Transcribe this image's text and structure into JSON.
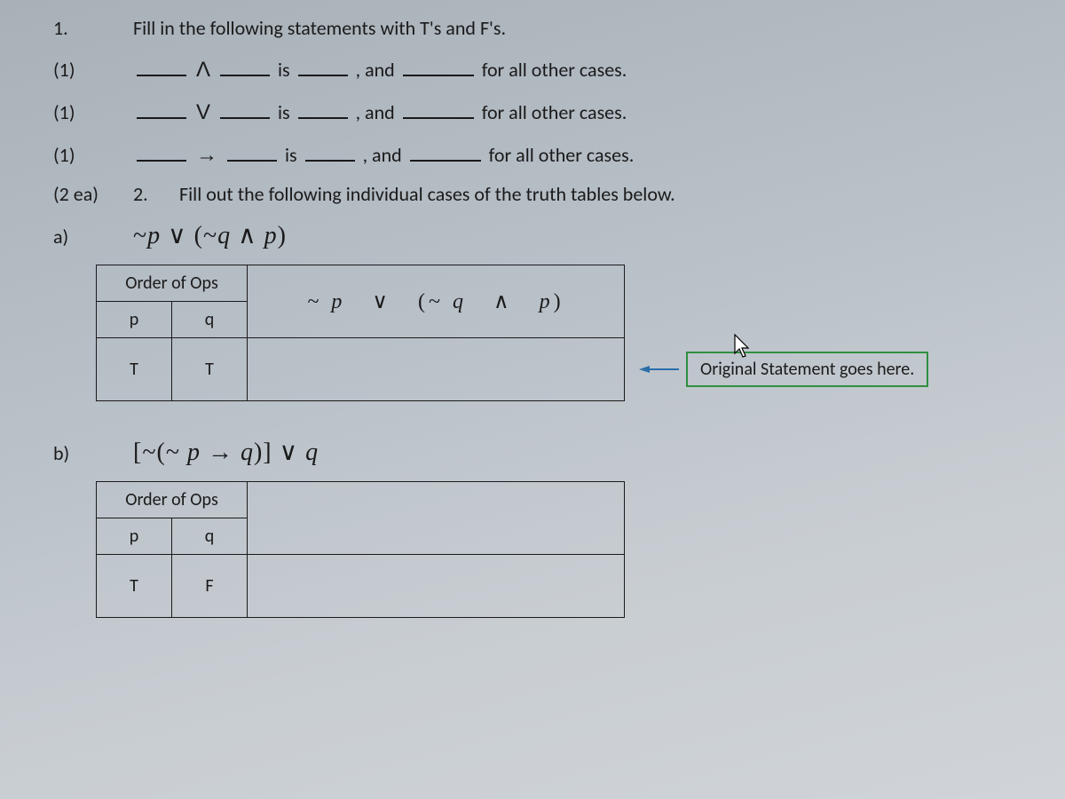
{
  "q1": {
    "number": "1.",
    "prompt": "Fill in the following statements with T's and F's.",
    "lines": [
      {
        "points": "(1)",
        "op": "Ʌ",
        "is": "is",
        "and": ", and",
        "tail": "for all other cases."
      },
      {
        "points": "(1)",
        "op": "V",
        "is": "is",
        "and": ", and",
        "tail": "for all other cases."
      },
      {
        "points": "(1)",
        "op": "→",
        "is": "is",
        "and": ", and",
        "tail": "for all other cases."
      }
    ]
  },
  "q2": {
    "points": "(2 ea)",
    "number": "2.",
    "prompt": "Fill out the following individual cases of the truth tables below."
  },
  "partA": {
    "label": "a)",
    "formula_parts": {
      "neg1": "~",
      "p1": "p",
      "or": "∨",
      "lp": "(",
      "neg2": "~",
      "q": "q",
      "and": "∧",
      "p2": "p",
      "rp": ")"
    },
    "table": {
      "ops_header": "Order of Ops",
      "p": "p",
      "q": "q",
      "expr_parts": {
        "neg1": "~",
        "p1": "p",
        "or": "∨",
        "lp": "(",
        "neg2": "~",
        "q": "q",
        "and": "∧",
        "p2": "p",
        "rp": ")"
      },
      "row": {
        "p": "T",
        "q": "T"
      }
    },
    "callout": "Original Statement goes here."
  },
  "partB": {
    "label": "b)",
    "formula_parts": {
      "lb": "[",
      "neg1": "~",
      "lp": "(",
      "neg2": "~",
      "p": "p",
      "imp": "→",
      "q1": "q",
      "rp": ")",
      "rb": "]",
      "or": "∨",
      "q2": "q"
    },
    "table": {
      "ops_header": "Order of Ops",
      "p": "p",
      "q": "q",
      "row": {
        "p": "T",
        "q": "F"
      }
    }
  }
}
